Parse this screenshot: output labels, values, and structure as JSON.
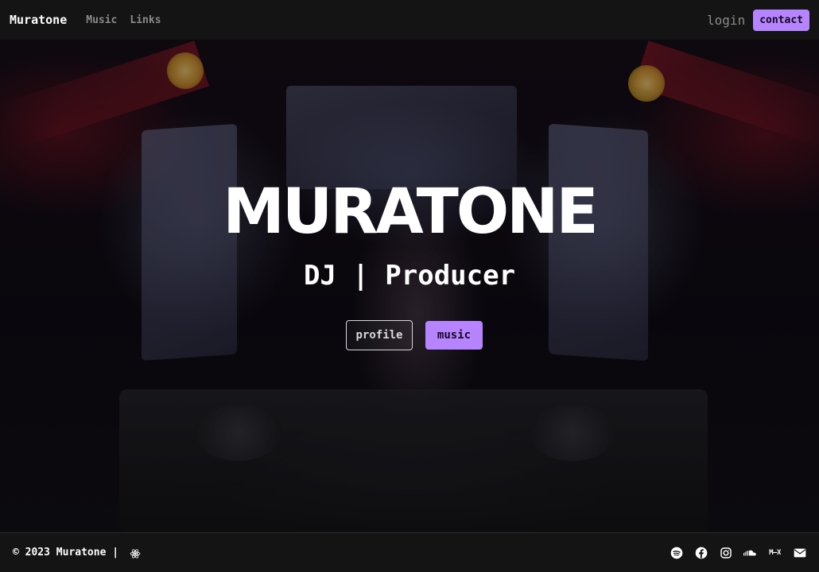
{
  "nav": {
    "brand": "Muratone",
    "links": [
      "Music",
      "Links"
    ],
    "login_label": "login",
    "contact_label": "contact"
  },
  "hero": {
    "title": "MURATONE",
    "subtitle": "DJ | Producer",
    "profile_button": "profile",
    "music_button": "music"
  },
  "footer": {
    "copyright": "© 2023 Muratone |",
    "mixcloud_label": "M—X",
    "icons": [
      "react-icon",
      "spotify-icon",
      "facebook-icon",
      "instagram-icon",
      "soundcloud-icon",
      "mixcloud-icon",
      "email-icon"
    ]
  },
  "colors": {
    "accent": "#b784ff",
    "bar_bg": "#141414",
    "muted_text": "#8a8a8a"
  }
}
